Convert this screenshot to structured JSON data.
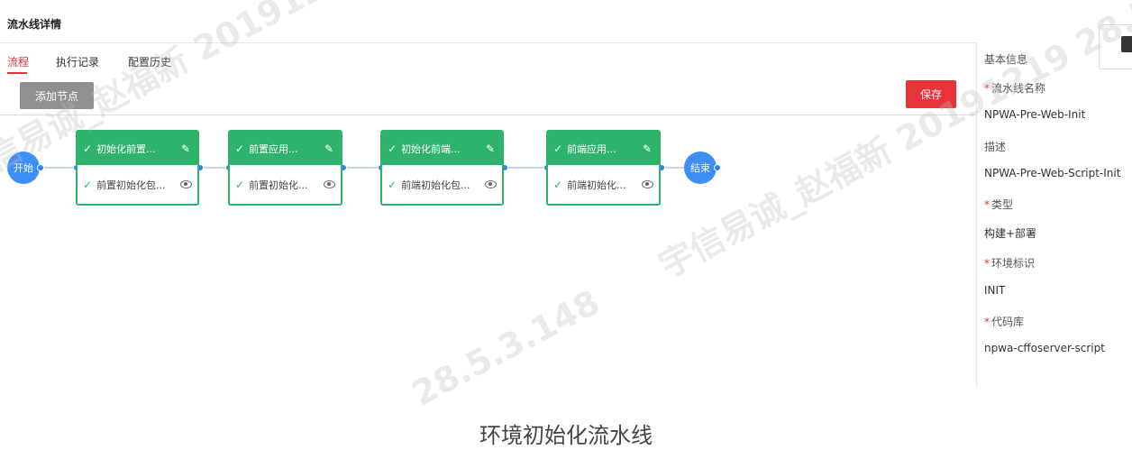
{
  "header": {
    "title": "流水线详情"
  },
  "tabs": [
    {
      "label": "流程",
      "active": true
    },
    {
      "label": "执行记录",
      "active": false
    },
    {
      "label": "配置历史",
      "active": false
    }
  ],
  "toolbar": {
    "add_node_label": "添加节点",
    "save_label": "保存"
  },
  "flow": {
    "start_label": "开始",
    "end_label": "结束",
    "nodes": [
      {
        "title": "初始化前置...",
        "step": "前置初始化包...",
        "header_icon": "check-icon",
        "edit_icon": "pencil-icon",
        "step_icon": "check-icon",
        "view_icon": "eye-icon"
      },
      {
        "title": "前置应用...",
        "step": "前置初始化...",
        "header_icon": "check-icon",
        "edit_icon": "pencil-icon",
        "step_icon": "check-icon",
        "view_icon": "eye-icon"
      },
      {
        "title": "初始化前端...",
        "step": "前端初始化包...",
        "header_icon": "check-icon",
        "edit_icon": "pencil-icon",
        "step_icon": "check-icon",
        "view_icon": "eye-icon"
      },
      {
        "title": "前端应用...",
        "step": "前端初始化...",
        "header_icon": "check-icon",
        "edit_icon": "pencil-icon",
        "step_icon": "check-icon",
        "view_icon": "eye-icon"
      }
    ]
  },
  "info_panel": {
    "title": "基本信息",
    "fields": [
      {
        "label": "流水线名称",
        "required": true,
        "value": "NPWA-Pre-Web-Init"
      },
      {
        "label": "描述",
        "required": false,
        "value": "NPWA-Pre-Web-Script-Init"
      },
      {
        "label": "类型",
        "required": true,
        "value": "构建+部署"
      },
      {
        "label": "环境标识",
        "required": true,
        "value": "INIT"
      },
      {
        "label": "代码库",
        "required": true,
        "value": "npwa-cffoserver-script"
      }
    ]
  },
  "caption": "环境初始化流水线",
  "watermark": {
    "line1": "宇信易诚_赵福新 20191219 28.5.3.148",
    "ip": "28.5.3.148"
  },
  "colors": {
    "accent_red": "#e8333a",
    "node_green": "#2db36b",
    "flow_blue": "#3d8ff5",
    "button_gray": "#8f9091"
  }
}
